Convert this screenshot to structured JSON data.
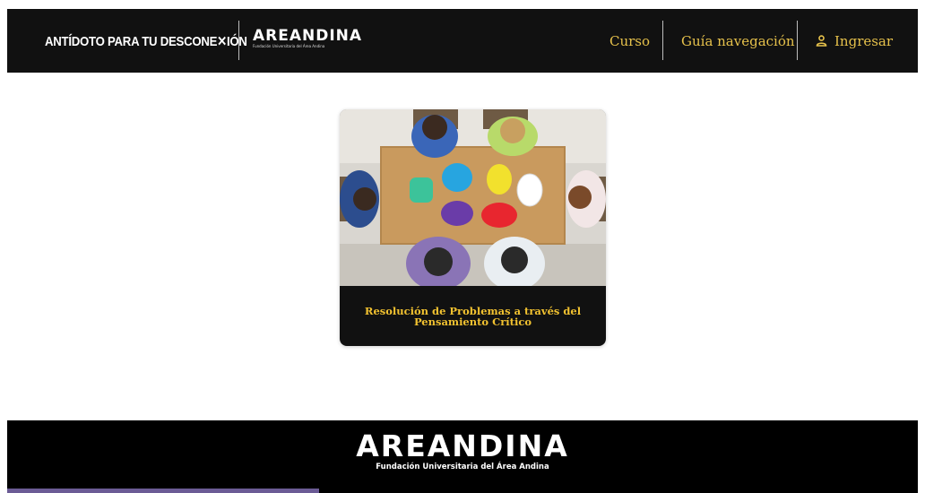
{
  "header": {
    "tagline": "ANTÍDOTO PARA TU DESCONE✕IÓN",
    "logo": {
      "word": "AREANDINA",
      "sub": "Fundación Universitaria del Área Andina"
    },
    "nav": {
      "curso": "Curso",
      "guia": "Guía navegación",
      "ingresar": "Ingresar",
      "ingresar_icon": "user-icon"
    },
    "accent_color": "#e6c14b"
  },
  "course_card": {
    "title": "Resolución de Problemas a través del Pensamiento Crítico",
    "title_color": "#f2c230"
  },
  "footer": {
    "logo": {
      "word": "AREANDINA",
      "sub": "Fundación Universitaria del Área Andina"
    },
    "strip_color": "#6b5b95"
  }
}
